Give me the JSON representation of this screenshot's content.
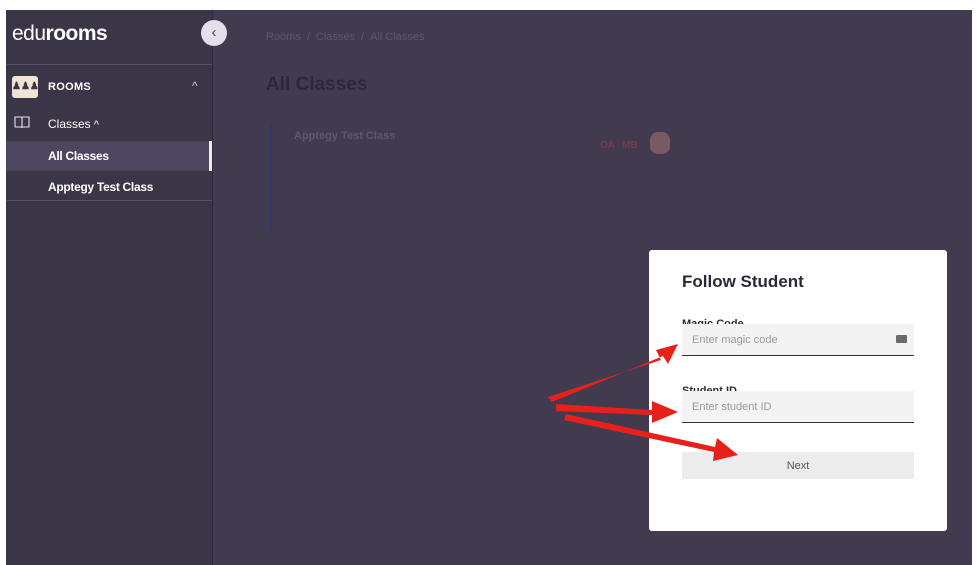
{
  "brand": {
    "prefix": "edu",
    "bold": "rooms"
  },
  "sidebar": {
    "collapse_glyph": "‹",
    "rooms": {
      "icon": "group-icon",
      "icon_text": "♟♟♟",
      "label": "ROOMS",
      "chevron": "^"
    },
    "classes": {
      "icon": "book-icon",
      "label": "Classes",
      "chevron": "^"
    },
    "items": [
      {
        "label": "All Classes",
        "active": true
      },
      {
        "label": "Apptegy Test Class",
        "active": false
      }
    ]
  },
  "breadcrumb": [
    "Rooms",
    "Classes",
    "All Classes"
  ],
  "breadcrumb_sep": "/",
  "page_title": "All Classes",
  "class_card": {
    "name": "Apptegy Test Class",
    "avatars": [
      "OA",
      "MB"
    ]
  },
  "modal": {
    "title": "Follow Student",
    "magic_code": {
      "label": "Magic Code",
      "placeholder": "Enter magic code"
    },
    "student_id": {
      "label": "Student ID",
      "placeholder": "Enter student ID"
    },
    "next_label": "Next"
  },
  "colors": {
    "overlay_bg": "#423b50",
    "sidebar_bg": "#3b3548",
    "arrow": "#e8201a",
    "accent_cream": "#f4ead9"
  }
}
